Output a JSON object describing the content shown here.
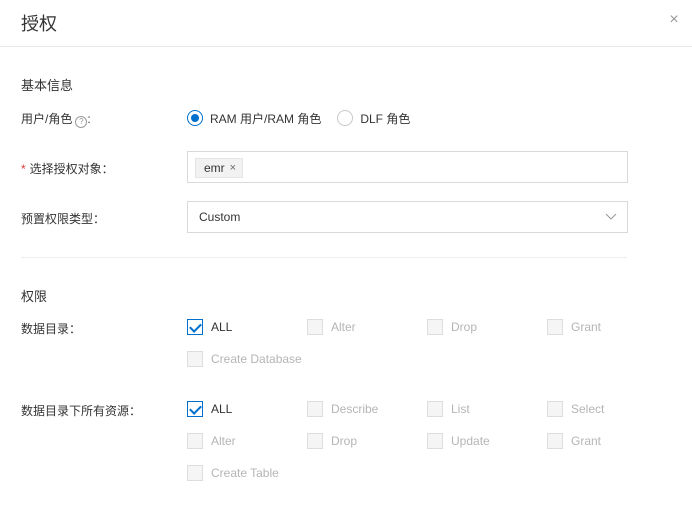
{
  "dialog": {
    "title": "授权",
    "close_icon": "×"
  },
  "basic": {
    "section_title": "基本信息",
    "user_role_label": "用户/角色",
    "help_icon": "?",
    "label_colon": ":",
    "radio_options": [
      "RAM 用户/RAM 角色",
      "DLF 角色"
    ],
    "selected_radio": "RAM 用户/RAM 角色",
    "target_label": "选择授权对象：",
    "required_mark": "*",
    "target_tags": [
      "emr"
    ],
    "tag_close": "×",
    "preset_label": "预置权限类型：",
    "preset_value": "Custom"
  },
  "permissions": {
    "section_title": "权限",
    "catalog_label": "数据目录：",
    "catalog_options": [
      {
        "label": "ALL",
        "checked": true
      },
      {
        "label": "Alter",
        "checked": false
      },
      {
        "label": "Drop",
        "checked": false
      },
      {
        "label": "Grant",
        "checked": false
      },
      {
        "label": "Create Database",
        "checked": false
      }
    ],
    "resources_label": "数据目录下所有资源：",
    "resource_options": [
      {
        "label": "ALL",
        "checked": true
      },
      {
        "label": "Describe",
        "checked": false
      },
      {
        "label": "List",
        "checked": false
      },
      {
        "label": "Select",
        "checked": false
      },
      {
        "label": "Alter",
        "checked": false
      },
      {
        "label": "Drop",
        "checked": false
      },
      {
        "label": "Update",
        "checked": false
      },
      {
        "label": "Grant",
        "checked": false
      },
      {
        "label": "Create Table",
        "checked": false
      }
    ]
  },
  "colors": {
    "primary": "#0070cc",
    "required": "#e23c39",
    "border": "#d9d9d9",
    "disabled_text": "#b5b5b5"
  }
}
